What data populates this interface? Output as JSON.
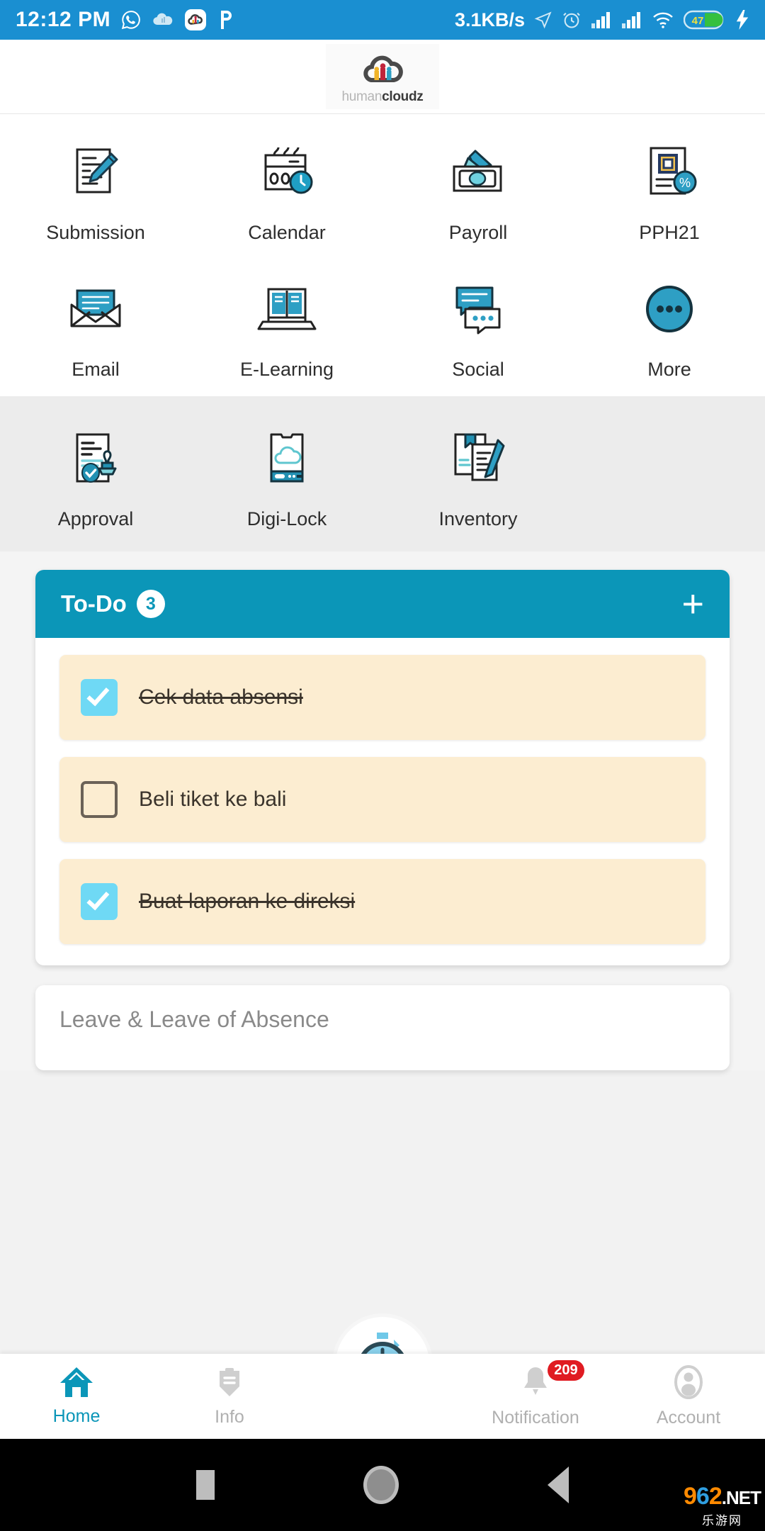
{
  "status_bar": {
    "time": "12:12 PM",
    "network_speed": "3.1KB/s",
    "battery_level": "47",
    "left_icons": [
      "whatsapp-icon",
      "cloud-icon",
      "humancloudz-app-icon",
      "p-app-icon"
    ],
    "right_icons": [
      "location-icon",
      "alarm-icon",
      "signal-bars-icon-1",
      "signal-bars-icon-2",
      "wifi-icon",
      "battery-icon",
      "charging-bolt-icon"
    ],
    "background_color": "#1a8fd1"
  },
  "header": {
    "logo_text_light": "human",
    "logo_text_bold": "cloudz",
    "logo_icon": "cloud-people-logo"
  },
  "menu": {
    "row1": [
      {
        "label": "Submission",
        "icon": "document-pen-icon"
      },
      {
        "label": "Calendar",
        "icon": "calendar-clock-icon"
      },
      {
        "label": "Payroll",
        "icon": "money-cash-icon"
      },
      {
        "label": "PPH21",
        "icon": "tax-document-percent-icon"
      }
    ],
    "row2": [
      {
        "label": "Email",
        "icon": "envelope-mail-icon"
      },
      {
        "label": "E-Learning",
        "icon": "laptop-book-icon"
      },
      {
        "label": "Social",
        "icon": "chat-bubbles-icon"
      },
      {
        "label": "More",
        "icon": "more-dots-circle-icon"
      }
    ],
    "row3": [
      {
        "label": "Approval",
        "icon": "document-stamp-icon"
      },
      {
        "label": "Digi-Lock",
        "icon": "phone-cloud-icon"
      },
      {
        "label": "Inventory",
        "icon": "documents-pen-icon"
      }
    ]
  },
  "todo_card": {
    "title": "To-Do",
    "count": "3",
    "add_label": "+",
    "header_color": "#0b96b8",
    "items": [
      {
        "text": "Cek data absensi",
        "checked": true
      },
      {
        "text": "Beli tiket ke bali",
        "checked": false
      },
      {
        "text": "Buat laporan ke direksi",
        "checked": true
      }
    ]
  },
  "second_card": {
    "title": "Leave & Leave of Absence"
  },
  "bottom_nav": {
    "items": [
      {
        "label": "Home",
        "icon": "home-icon",
        "active": true,
        "badge": ""
      },
      {
        "label": "Info",
        "icon": "info-envelope-icon",
        "active": false,
        "badge": ""
      },
      {
        "label": "",
        "icon": "stopwatch-icon",
        "active": false,
        "badge": ""
      },
      {
        "label": "Notification",
        "icon": "bell-icon",
        "active": false,
        "badge": "209"
      },
      {
        "label": "Account",
        "icon": "account-person-icon",
        "active": false,
        "badge": ""
      }
    ],
    "active_color": "#0b96b8",
    "inactive_color": "#b0b0b0",
    "badge_color": "#e01b22"
  },
  "android_nav": {
    "buttons": [
      "recent-apps-square-icon",
      "home-circle-icon",
      "back-triangle-icon"
    ]
  },
  "watermark": {
    "digit1": "9",
    "digit2": "6",
    "digit3": "2",
    "suffix": ".NET",
    "subtitle": "乐游网"
  }
}
